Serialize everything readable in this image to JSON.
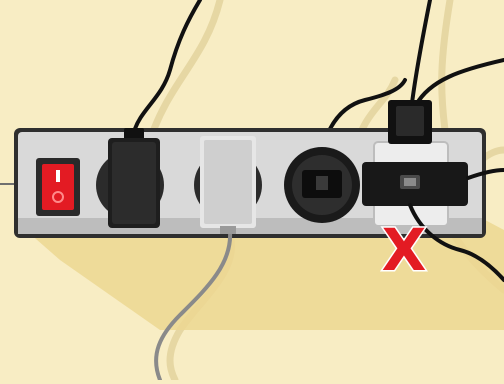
{
  "illustration": {
    "warning_mark": "X",
    "colors": {
      "background": "#f8edc4",
      "shadow": "#e8d49a",
      "strip_body": "#dcdcdc",
      "strip_frame": "#3a3a3a",
      "switch": "#e31b23",
      "cable": "#111111",
      "white_plug": "#e6e6e6",
      "grey_cable": "#8a8a8a",
      "warning": "#e31b23"
    },
    "objects": [
      "power-strip",
      "power-switch",
      "black-plug",
      "white-plug",
      "round-adapter",
      "stacked-adapter"
    ]
  }
}
